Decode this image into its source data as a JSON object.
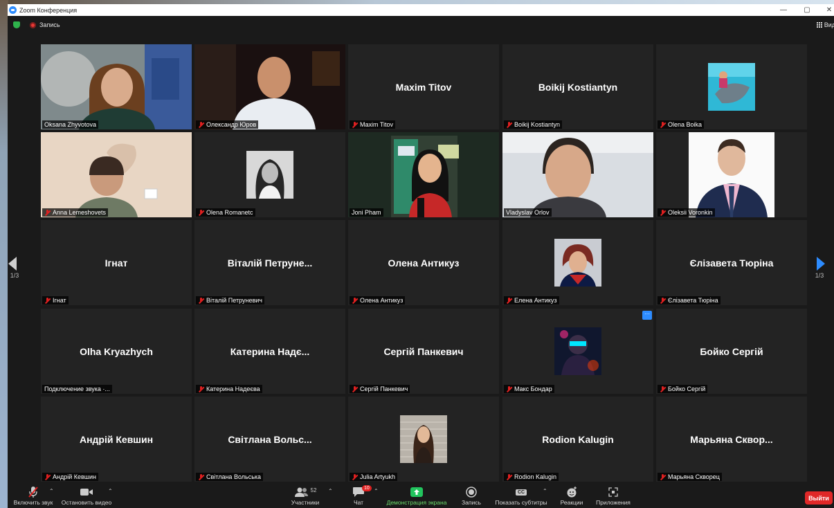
{
  "window": {
    "title": "Zoom Конференция",
    "controls": [
      "—",
      "▢",
      "✕"
    ]
  },
  "topbar": {
    "record_label": "Запись",
    "view_label": "Вид"
  },
  "pagination": {
    "left": "1/3",
    "right": "1/3"
  },
  "tiles": [
    {
      "label": "Oksana Zhyvotova",
      "big": "",
      "muted": false,
      "type": "video",
      "photo": "oksana"
    },
    {
      "label": "Олександр Юров",
      "big": "",
      "muted": true,
      "type": "video",
      "photo": "oleksandr"
    },
    {
      "label": "Maxim Titov",
      "big": "Maxim Titov",
      "muted": true,
      "type": "name"
    },
    {
      "label": "Boikij Kostiantyn",
      "big": "Boikij Kostiantyn",
      "muted": true,
      "type": "name"
    },
    {
      "label": "Olena Boika",
      "big": "",
      "muted": true,
      "type": "avatar",
      "photo": "dolphin"
    },
    {
      "label": "Anna Lemeshovets",
      "big": "",
      "muted": true,
      "type": "video",
      "photo": "anna"
    },
    {
      "label": "Olena Romanetc",
      "big": "",
      "muted": true,
      "type": "avatar",
      "photo": "olena-r"
    },
    {
      "label": "Joni Pham",
      "big": "",
      "muted": false,
      "type": "video",
      "photo": "joni",
      "active": true
    },
    {
      "label": "Vladyslav Orlov",
      "big": "",
      "muted": false,
      "type": "video",
      "photo": "vlad"
    },
    {
      "label": "Oleksii Voronkin",
      "big": "",
      "muted": true,
      "type": "avatar-wide",
      "photo": "oleksii"
    },
    {
      "label": "Ігнат",
      "big": "Ігнат",
      "muted": true,
      "type": "name"
    },
    {
      "label": "Віталій Петруневич",
      "big": "Віталій Петруне...",
      "muted": true,
      "type": "name"
    },
    {
      "label": "Олена Антикуз",
      "big": "Олена Антикуз",
      "muted": true,
      "type": "name"
    },
    {
      "label": "Елена Антикуз",
      "big": "",
      "muted": true,
      "type": "avatar",
      "photo": "elena"
    },
    {
      "label": "Єлізавета Тюріна",
      "big": "Єлізавета Тюріна",
      "muted": true,
      "type": "name"
    },
    {
      "label": "Подключение звука ·...",
      "big": "Olha Kryazhych",
      "muted": false,
      "type": "name"
    },
    {
      "label": "Катерина Надеєва",
      "big": "Катерина Надє...",
      "muted": true,
      "type": "name"
    },
    {
      "label": "Сергій Панкевич",
      "big": "Сергій Панкевич",
      "muted": true,
      "type": "name"
    },
    {
      "label": "Макс Бондар",
      "big": "",
      "muted": true,
      "type": "avatar",
      "photo": "maks"
    },
    {
      "label": "Бойко Сергій",
      "big": "Бойко Сергій",
      "muted": true,
      "type": "name"
    },
    {
      "label": "Андрій Кевшин",
      "big": "Андрій Кевшин",
      "muted": true,
      "type": "name"
    },
    {
      "label": "Світлана Вольська",
      "big": "Світлана Вольс...",
      "muted": true,
      "type": "name"
    },
    {
      "label": "Julia Artyukh",
      "big": "",
      "muted": true,
      "type": "avatar",
      "photo": "julia"
    },
    {
      "label": "Rodion Kalugin",
      "big": "Rodion Kalugin",
      "muted": true,
      "type": "name"
    },
    {
      "label": "Марьяна Скворец",
      "big": "Марьяна Сквор...",
      "muted": true,
      "type": "name"
    }
  ],
  "more_button": "···",
  "toolbar": {
    "unmute": "Включить звук",
    "stop_video": "Остановить видео",
    "participants": "Участники",
    "participants_count": "52",
    "chat": "Чат",
    "chat_badge": "10",
    "share": "Демонстрация экрана",
    "record": "Запись",
    "captions": "Показать субтитры",
    "reactions": "Реакции",
    "apps": "Приложения",
    "leave": "Выйти",
    "cc_icon_text": "CC"
  },
  "colors": {
    "share_green": "#22c55e",
    "leave_red": "#e02828",
    "active_border": "#d4e157",
    "accent_blue": "#2d8cff"
  }
}
